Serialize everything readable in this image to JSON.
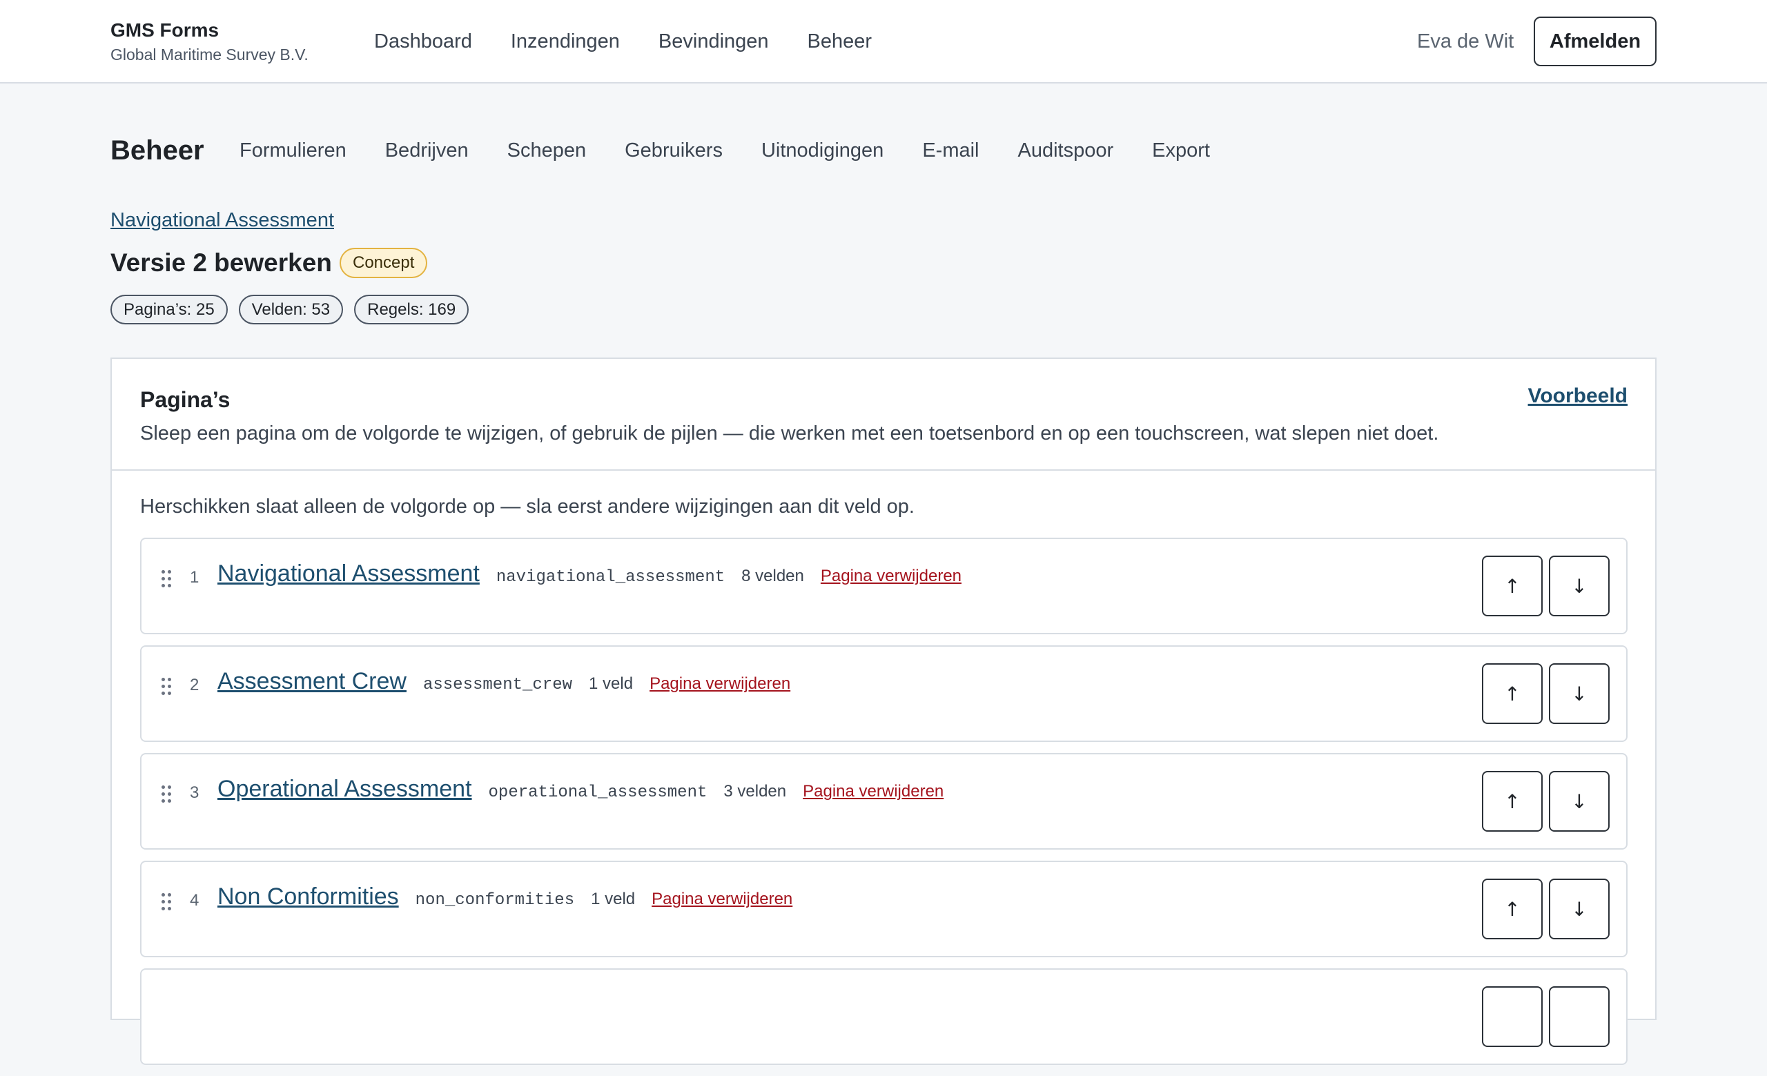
{
  "header": {
    "brand_title": "GMS Forms",
    "brand_subtitle": "Global Maritime Survey B.V.",
    "nav": [
      "Dashboard",
      "Inzendingen",
      "Bevindingen",
      "Beheer"
    ],
    "user_name": "Eva de Wit",
    "logout_label": "Afmelden"
  },
  "admin": {
    "title": "Beheer",
    "nav": [
      "Formulieren",
      "Bedrijven",
      "Schepen",
      "Gebruikers",
      "Uitnodigingen",
      "E-mail",
      "Auditspoor",
      "Export"
    ]
  },
  "form": {
    "breadcrumb": "Navigational Assessment",
    "title": "Versie 2 bewerken",
    "status": "Concept",
    "stats": [
      "Pagina’s: 25",
      "Velden: 53",
      "Regels: 169"
    ]
  },
  "pages_panel": {
    "title": "Pagina’s",
    "preview_label": "Voorbeeld",
    "description": "Sleep een pagina om de volgorde te wijzigen, of gebruik de pijlen — die werken met een toetsenbord en op een touchscreen, wat slepen niet doet.",
    "note": "Herschikken slaat alleen de volgorde op — sla eerst andere wijzigingen aan dit veld op.",
    "delete_label": "Pagina verwijderen",
    "up_icon": "↑",
    "down_icon": "↓",
    "drag_icon": "drag-handle-icon",
    "rows": [
      {
        "num": "1",
        "title": "Navigational Assessment",
        "key": "navigational_assessment",
        "count": "8 velden"
      },
      {
        "num": "2",
        "title": "Assessment Crew",
        "key": "assessment_crew",
        "count": "1 veld"
      },
      {
        "num": "3",
        "title": "Operational Assessment",
        "key": "operational_assessment",
        "count": "3 velden"
      },
      {
        "num": "4",
        "title": "Non Conformities",
        "key": "non_conformities",
        "count": "1 veld"
      }
    ]
  },
  "colors": {
    "link": "#1d4e6e",
    "danger": "#a4131d",
    "badge_bg": "#fdf3d6",
    "badge_border": "#e3b341"
  }
}
